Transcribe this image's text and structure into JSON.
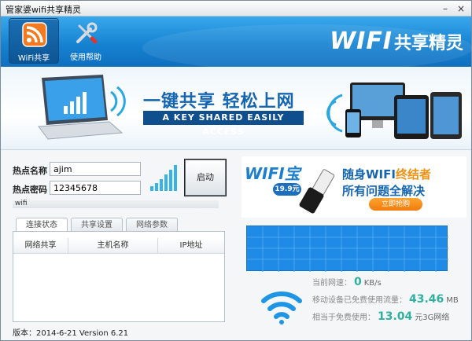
{
  "window": {
    "title": "管家婆wifi共享精灵",
    "minimize": "–",
    "close": "×"
  },
  "nav": [
    {
      "label": "WiFi共享"
    },
    {
      "label": "使用帮助"
    }
  ],
  "brand": {
    "wifi": "WIFI",
    "cn": "共享精灵"
  },
  "banner": {
    "slogan": "一键共享 轻松上网",
    "slogan_en": "A KEY SHARED EASILY ACCESS"
  },
  "form": {
    "ssid_label": "热点名称",
    "ssid_value": "ajim",
    "pwd_label": "热点密码",
    "pwd_value": "12345678",
    "start_label": "启动",
    "ssid_bar_text": "wifi"
  },
  "tabs": [
    {
      "label": "连接状态"
    },
    {
      "label": "共享设置"
    },
    {
      "label": "网络参数"
    }
  ],
  "table": {
    "headers": [
      "网络共享",
      "主机名称",
      "IP地址"
    ]
  },
  "version": "版本：2014-6-21 Version 6.21",
  "ad": {
    "logo": "WIFI宝",
    "price": "19.9元",
    "line1_a": "随身WIFI",
    "line1_b": "终结者",
    "line2": "所有问题全解决",
    "buy": "立即抢购"
  },
  "stats": {
    "speed_label": "当前网速：",
    "speed_value": "0",
    "speed_unit": "KB/s",
    "traffic_label": "移动设备已免费使用流量：",
    "traffic_value": "43.46",
    "traffic_unit": "MB",
    "equiv_label": "相当于免费使用：",
    "equiv_value": "13.04",
    "equiv_unit": "元3G网络"
  },
  "colors": {
    "header": "#1683d2",
    "graph": "#1f8be6",
    "accent_teal": "#2fb0a0",
    "accent_orange": "#f07b0b"
  }
}
